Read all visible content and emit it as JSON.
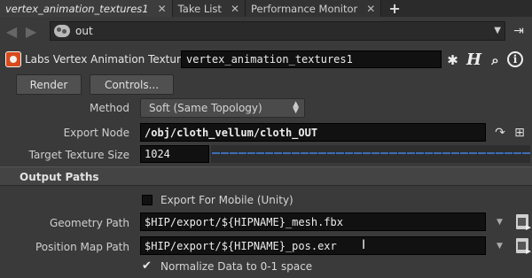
{
  "tabs": [
    {
      "label": "vertex_animation_textures1",
      "close": "✕",
      "active": true
    },
    {
      "label": "Take List",
      "close": "✕",
      "active": false
    },
    {
      "label": "Performance Monitor",
      "close": "✕",
      "active": false
    }
  ],
  "tab_add": "+",
  "pathbar": {
    "path": "out"
  },
  "node": {
    "type_label": "Labs Vertex Animation Textures",
    "name": "vertex_animation_textures1"
  },
  "buttons": {
    "render": "Render",
    "controls": "Controls..."
  },
  "params": {
    "method": {
      "label": "Method",
      "value": "Soft (Same Topology)"
    },
    "export_node": {
      "label": "Export Node",
      "value": "/obj/cloth_vellum/cloth_OUT"
    },
    "target_texture_size": {
      "label": "Target Texture Size",
      "value": "1024"
    }
  },
  "section": {
    "title": "Output Paths"
  },
  "export_mobile": {
    "label": "Export For Mobile (Unity)",
    "checked": false
  },
  "geometry_path": {
    "label": "Geometry Path",
    "value": "$HIP/export/${HIPNAME}_mesh.fbx"
  },
  "position_map_path": {
    "label": "Position Map Path",
    "value": "$HIP/export/${HIPNAME}_pos.exr"
  },
  "normalize": {
    "label": "Normalize Data to 0-1 space",
    "checked": true
  },
  "colors": {
    "accent_blue": "#3d6cb0",
    "node_icon": "#d84a1b"
  }
}
